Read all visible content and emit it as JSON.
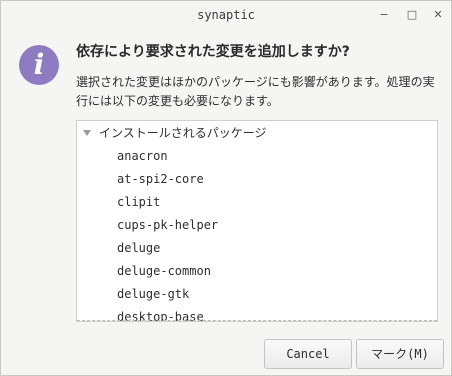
{
  "window": {
    "title": "synaptic",
    "controls": {
      "minimize": "−",
      "maximize": "□",
      "close": "✕"
    }
  },
  "dialog": {
    "icon": "info-icon",
    "icon_glyph": "i",
    "icon_color": "#8e7cc3",
    "heading": "依存により要求された変更を追加しますか?",
    "message": "選択された変更はほかのパッケージにも影響があります。処理の実行には以下の変更も必要になります。"
  },
  "changes": {
    "group_label": "インストールされるパッケージ",
    "packages": [
      "anacron",
      "at-spi2-core",
      "clipit",
      "cups-pk-helper",
      "deluge",
      "deluge-common",
      "deluge-gtk",
      "desktop-base"
    ]
  },
  "buttons": {
    "cancel": "Cancel",
    "mark": "マーク(M)"
  }
}
